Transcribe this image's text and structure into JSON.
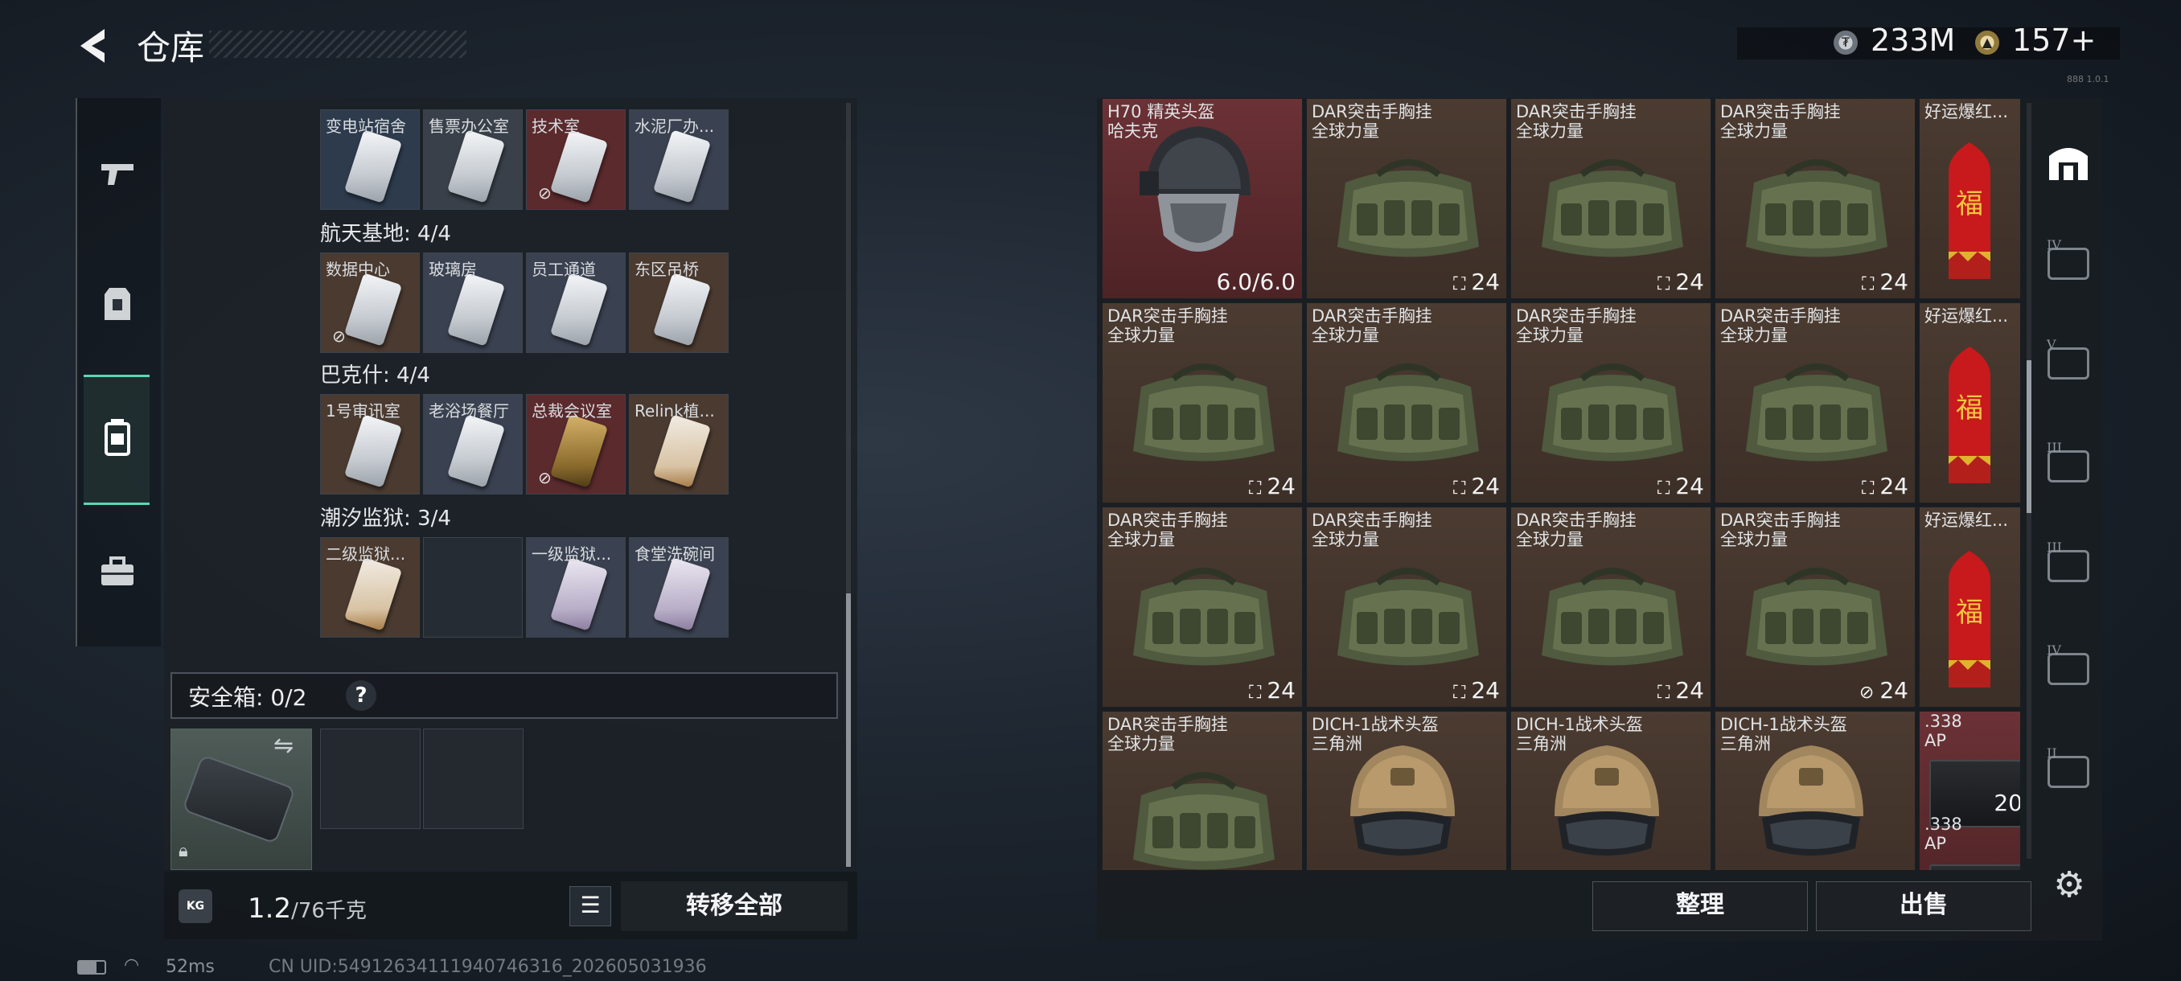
{
  "header": {
    "title": "仓库",
    "currency_money": "233M",
    "currency_points": "157+",
    "corner_text": "888 1.0.1"
  },
  "left_nav": {
    "items": [
      "weapons",
      "equipment",
      "containers",
      "toolbox"
    ],
    "active": "containers"
  },
  "keycard_groups": [
    {
      "name": "",
      "cards": [
        {
          "label": "变电站宿舍",
          "color": "blue",
          "no_tag": false
        },
        {
          "label": "售票办公室",
          "color": "gray",
          "no_tag": false
        },
        {
          "label": "技术室",
          "color": "red",
          "no_tag": true
        },
        {
          "label": "水泥厂办...",
          "color": "slate",
          "no_tag": false
        }
      ]
    },
    {
      "name": "航天基地: 4/4",
      "cards": [
        {
          "label": "数据中心",
          "color": "brown",
          "no_tag": true
        },
        {
          "label": "玻璃房",
          "color": "slate",
          "no_tag": false
        },
        {
          "label": "员工通道",
          "color": "slate",
          "no_tag": false
        },
        {
          "label": "东区吊桥",
          "color": "brown",
          "no_tag": false
        }
      ]
    },
    {
      "name": "巴克什: 4/4",
      "cards": [
        {
          "label": "1号审讯室",
          "color": "brown",
          "no_tag": false
        },
        {
          "label": "老浴场餐厅",
          "color": "slate",
          "no_tag": false
        },
        {
          "label": "总裁会议室",
          "color": "red",
          "no_tag": true
        },
        {
          "label": "Relink植...",
          "color": "brown",
          "no_tag": false
        }
      ]
    },
    {
      "name": "潮汐监狱: 3/4",
      "cards": [
        {
          "label": "二级监狱...",
          "color": "brown",
          "no_tag": false
        },
        {
          "label": "",
          "color": "empty",
          "no_tag": false
        },
        {
          "label": "一级监狱...",
          "color": "slate",
          "no_tag": false
        },
        {
          "label": "食堂洗碗间",
          "color": "slate",
          "no_tag": false
        }
      ]
    }
  ],
  "safe_box": {
    "label": "安全箱: 0/2",
    "help": "?"
  },
  "bottom_left": {
    "weight_main": "1.2",
    "weight_sub": "/76千克",
    "kg_icon": "KG",
    "transfer_all": "转移全部"
  },
  "stash_items": [
    [
      {
        "name": "H70 精英头盔",
        "sub": "哈夫克",
        "type": "helmet-black",
        "rarity": "red",
        "durability": "6.0/6.0"
      },
      {
        "name": "DAR突击手胸挂",
        "sub": "全球力量",
        "type": "vest",
        "rarity": "brown",
        "count": "24",
        "no_tag": false
      },
      {
        "name": "DAR突击手胸挂",
        "sub": "全球力量",
        "type": "vest",
        "rarity": "brown",
        "count": "24",
        "no_tag": false
      },
      {
        "name": "DAR突击手胸挂",
        "sub": "全球力量",
        "type": "vest",
        "rarity": "brown",
        "count": "24",
        "no_tag": false
      },
      {
        "name": "好运爆红...",
        "sub": "",
        "type": "firework",
        "rarity": "brown"
      }
    ],
    [
      {
        "name": "DAR突击手胸挂",
        "sub": "全球力量",
        "type": "vest",
        "rarity": "brown",
        "count": "24",
        "no_tag": false
      },
      {
        "name": "DAR突击手胸挂",
        "sub": "全球力量",
        "type": "vest",
        "rarity": "brown",
        "count": "24",
        "no_tag": false
      },
      {
        "name": "DAR突击手胸挂",
        "sub": "全球力量",
        "type": "vest",
        "rarity": "brown",
        "count": "24",
        "no_tag": false
      },
      {
        "name": "DAR突击手胸挂",
        "sub": "全球力量",
        "type": "vest",
        "rarity": "brown",
        "count": "24",
        "no_tag": false
      },
      {
        "name": "好运爆红...",
        "sub": "",
        "type": "firework",
        "rarity": "brown"
      }
    ],
    [
      {
        "name": "DAR突击手胸挂",
        "sub": "全球力量",
        "type": "vest",
        "rarity": "brown",
        "count": "24",
        "no_tag": false
      },
      {
        "name": "DAR突击手胸挂",
        "sub": "全球力量",
        "type": "vest",
        "rarity": "brown",
        "count": "24",
        "no_tag": false
      },
      {
        "name": "DAR突击手胸挂",
        "sub": "全球力量",
        "type": "vest",
        "rarity": "brown",
        "count": "24",
        "no_tag": false
      },
      {
        "name": "DAR突击手胸挂",
        "sub": "全球力量",
        "type": "vest",
        "rarity": "brown",
        "count": "24",
        "no_tag": true
      },
      {
        "name": "好运爆红...",
        "sub": "",
        "type": "firework",
        "rarity": "brown"
      }
    ],
    [
      {
        "name": "DAR突击手胸挂",
        "sub": "全球力量",
        "type": "vest",
        "rarity": "brown"
      },
      {
        "name": "DICH-1战术头盔",
        "sub": "三角洲",
        "type": "helmet-tan",
        "rarity": "brown"
      },
      {
        "name": "DICH-1战术头盔",
        "sub": "三角洲",
        "type": "helmet-tan",
        "rarity": "brown"
      },
      {
        "name": "DICH-1战术头盔",
        "sub": "三角洲",
        "type": "helmet-tan",
        "rarity": "brown"
      },
      {
        "name": ".338",
        "sub": "AP",
        "type": "ammo",
        "rarity": "red",
        "count": "20",
        "extra_name": ".338",
        "extra_sub": "AP"
      }
    ]
  ],
  "right_nav": [
    "home-icon",
    "IV",
    "V",
    "III",
    "III",
    "IV",
    "II"
  ],
  "buttons": {
    "sort": "整理",
    "sell": "出售"
  },
  "footer": {
    "ping": "52ms",
    "uid": "CN UID:54912634111940746316_202605031936"
  },
  "colors": {
    "accent": "#5bd7b5",
    "rarity_red": "#6b3236",
    "rarity_brown": "#4b3b31"
  }
}
